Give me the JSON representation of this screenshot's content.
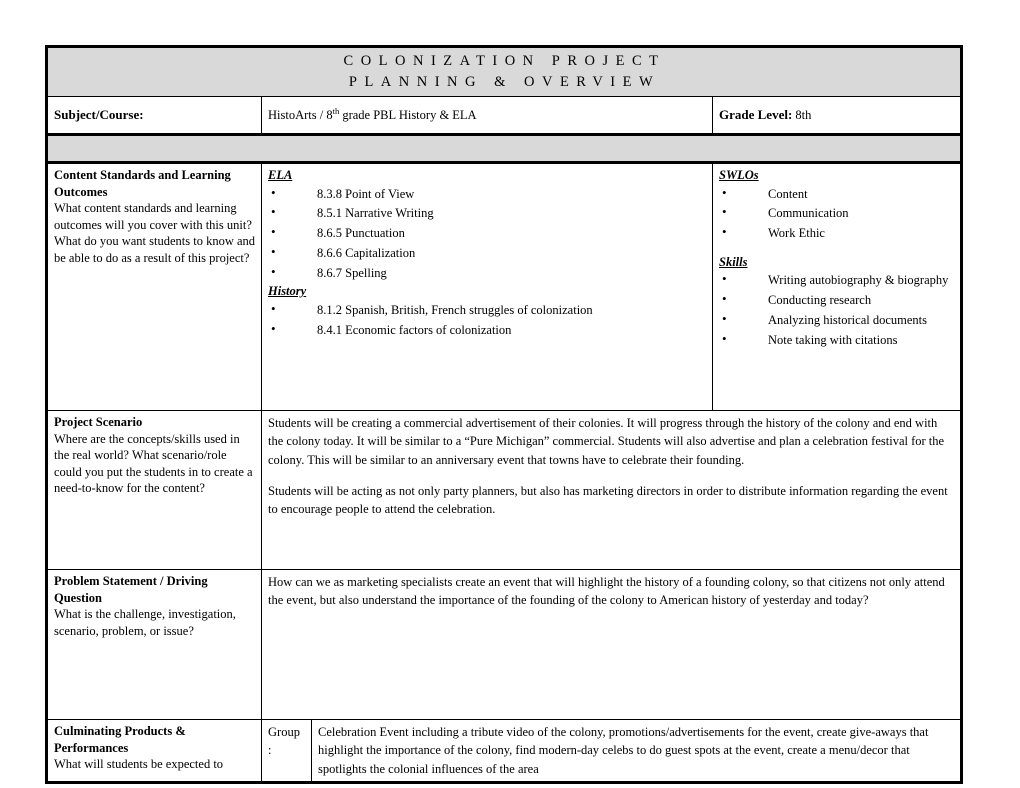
{
  "document": {
    "title_line_1": "COLONIZATION PROJECT",
    "title_line_2": "PLANNING & OVERVIEW"
  },
  "subject_row": {
    "subject_label": "Subject/Course:",
    "subject_value_prefix": "HistoArts / 8",
    "subject_value_superscript": "th",
    "subject_value_suffix": " grade PBL History & ELA",
    "grade_label": "Grade Level:",
    "grade_value": "8th"
  },
  "rows": {
    "standards": {
      "prompt_title": "Content Standards and Learning Outcomes",
      "prompt_body": "What content standards and learning outcomes will you cover with this unit?  What do you want students to know and be able to do as a result of this project?",
      "ela_heading": "ELA",
      "ela_items": [
        "8.3.8 Point of View",
        "8.5.1 Narrative Writing",
        "8.6.5 Punctuation",
        "8.6.6 Capitalization",
        "8.6.7 Spelling"
      ],
      "history_heading": "History",
      "history_items": [
        "8.1.2 Spanish, British, French struggles of colonization",
        "8.4.1 Economic factors of colonization"
      ],
      "swlos_heading": "SWLOs",
      "swlos_items": [
        "Content",
        "Communication",
        "Work Ethic"
      ],
      "skills_heading": "Skills",
      "skills_items": [
        "Writing autobiography & biography",
        "Conducting research",
        "Analyzing historical documents",
        "Note taking with citations"
      ]
    },
    "scenario": {
      "prompt_title": "Project Scenario",
      "prompt_body": "Where are the concepts/skills used in the real world?  What scenario/role could you put the students in to create a need-to-know for the content?",
      "paragraph_1": "Students will be creating a commercial advertisement of their colonies.  It will progress through the history of the colony and end with the colony today.  It will be similar to a “Pure Michigan” commercial.  Students will also advertise and plan a celebration festival for the colony.  This will be similar to an anniversary event that towns have to celebrate their founding.",
      "paragraph_2": "Students will be acting as not only party planners, but also has marketing directors in order to distribute information regarding the event to encourage people to attend the celebration."
    },
    "problem": {
      "prompt_title": "Problem Statement / Driving Question",
      "prompt_body": "What is the challenge, investigation, scenario, problem, or issue?",
      "paragraph_1": "How can we as marketing specialists create an event that will highlight the history of a founding colony, so that citizens not only attend the event, but also understand the importance of the founding of the colony to American history of yesterday and today?"
    },
    "culminating": {
      "prompt_title": "Culminating Products & Performances",
      "prompt_body": "What will students be expected to",
      "group_label_line_1": "Group",
      "group_label_line_2": ":",
      "paragraph_1": "Celebration Event including a tribute video of the colony, promotions/advertisements for the event, create give-aways that highlight the importance of the colony, find modern-day celebs to do guest spots at the event, create a menu/decor that spotlights the colonial influences of the area"
    }
  },
  "colors": {
    "banner_background": "#d9d9d9",
    "border": "#000000",
    "text": "#000000",
    "page_background": "#ffffff"
  }
}
